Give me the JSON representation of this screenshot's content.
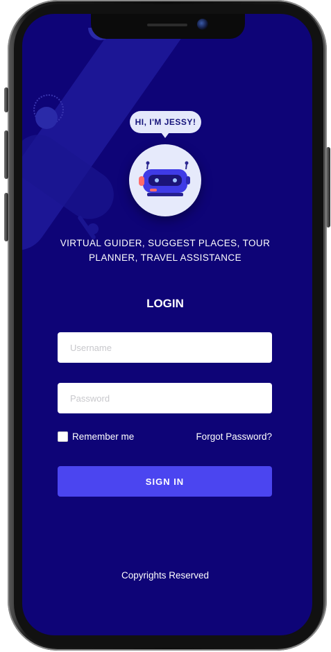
{
  "bubble": {
    "text": "HI, I'M JESSY!"
  },
  "tagline": {
    "line1": "VIRTUAL GUIDER, SUGGEST PLACES, TOUR",
    "line2": "PLANNER, TRAVEL ASSISTANCE"
  },
  "login": {
    "title": "LOGIN",
    "username_placeholder": "Username",
    "password_placeholder": "Password",
    "remember_label": "Remember me",
    "forgot_label": "Forgot Password?",
    "signin_label": "SIGN IN"
  },
  "footer": {
    "text": "Copyrights Reserved"
  },
  "colors": {
    "screen_bg": "#0e0477",
    "accent_button": "#4b45f0",
    "bubble_bg": "#e4e8fb",
    "bot_body": "#3f3be6"
  },
  "icons": {
    "avatar": "robot-icon",
    "camera": "camera-icon"
  }
}
